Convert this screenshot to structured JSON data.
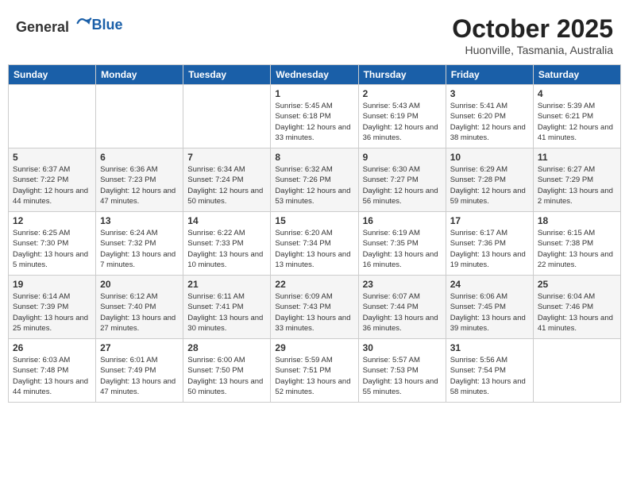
{
  "header": {
    "logo_general": "General",
    "logo_blue": "Blue",
    "month_year": "October 2025",
    "location": "Huonville, Tasmania, Australia"
  },
  "weekdays": [
    "Sunday",
    "Monday",
    "Tuesday",
    "Wednesday",
    "Thursday",
    "Friday",
    "Saturday"
  ],
  "weeks": [
    [
      {
        "day": "",
        "info": ""
      },
      {
        "day": "",
        "info": ""
      },
      {
        "day": "",
        "info": ""
      },
      {
        "day": "1",
        "info": "Sunrise: 5:45 AM\nSunset: 6:18 PM\nDaylight: 12 hours\nand 33 minutes."
      },
      {
        "day": "2",
        "info": "Sunrise: 5:43 AM\nSunset: 6:19 PM\nDaylight: 12 hours\nand 36 minutes."
      },
      {
        "day": "3",
        "info": "Sunrise: 5:41 AM\nSunset: 6:20 PM\nDaylight: 12 hours\nand 38 minutes."
      },
      {
        "day": "4",
        "info": "Sunrise: 5:39 AM\nSunset: 6:21 PM\nDaylight: 12 hours\nand 41 minutes."
      }
    ],
    [
      {
        "day": "5",
        "info": "Sunrise: 6:37 AM\nSunset: 7:22 PM\nDaylight: 12 hours\nand 44 minutes."
      },
      {
        "day": "6",
        "info": "Sunrise: 6:36 AM\nSunset: 7:23 PM\nDaylight: 12 hours\nand 47 minutes."
      },
      {
        "day": "7",
        "info": "Sunrise: 6:34 AM\nSunset: 7:24 PM\nDaylight: 12 hours\nand 50 minutes."
      },
      {
        "day": "8",
        "info": "Sunrise: 6:32 AM\nSunset: 7:26 PM\nDaylight: 12 hours\nand 53 minutes."
      },
      {
        "day": "9",
        "info": "Sunrise: 6:30 AM\nSunset: 7:27 PM\nDaylight: 12 hours\nand 56 minutes."
      },
      {
        "day": "10",
        "info": "Sunrise: 6:29 AM\nSunset: 7:28 PM\nDaylight: 12 hours\nand 59 minutes."
      },
      {
        "day": "11",
        "info": "Sunrise: 6:27 AM\nSunset: 7:29 PM\nDaylight: 13 hours\nand 2 minutes."
      }
    ],
    [
      {
        "day": "12",
        "info": "Sunrise: 6:25 AM\nSunset: 7:30 PM\nDaylight: 13 hours\nand 5 minutes."
      },
      {
        "day": "13",
        "info": "Sunrise: 6:24 AM\nSunset: 7:32 PM\nDaylight: 13 hours\nand 7 minutes."
      },
      {
        "day": "14",
        "info": "Sunrise: 6:22 AM\nSunset: 7:33 PM\nDaylight: 13 hours\nand 10 minutes."
      },
      {
        "day": "15",
        "info": "Sunrise: 6:20 AM\nSunset: 7:34 PM\nDaylight: 13 hours\nand 13 minutes."
      },
      {
        "day": "16",
        "info": "Sunrise: 6:19 AM\nSunset: 7:35 PM\nDaylight: 13 hours\nand 16 minutes."
      },
      {
        "day": "17",
        "info": "Sunrise: 6:17 AM\nSunset: 7:36 PM\nDaylight: 13 hours\nand 19 minutes."
      },
      {
        "day": "18",
        "info": "Sunrise: 6:15 AM\nSunset: 7:38 PM\nDaylight: 13 hours\nand 22 minutes."
      }
    ],
    [
      {
        "day": "19",
        "info": "Sunrise: 6:14 AM\nSunset: 7:39 PM\nDaylight: 13 hours\nand 25 minutes."
      },
      {
        "day": "20",
        "info": "Sunrise: 6:12 AM\nSunset: 7:40 PM\nDaylight: 13 hours\nand 27 minutes."
      },
      {
        "day": "21",
        "info": "Sunrise: 6:11 AM\nSunset: 7:41 PM\nDaylight: 13 hours\nand 30 minutes."
      },
      {
        "day": "22",
        "info": "Sunrise: 6:09 AM\nSunset: 7:43 PM\nDaylight: 13 hours\nand 33 minutes."
      },
      {
        "day": "23",
        "info": "Sunrise: 6:07 AM\nSunset: 7:44 PM\nDaylight: 13 hours\nand 36 minutes."
      },
      {
        "day": "24",
        "info": "Sunrise: 6:06 AM\nSunset: 7:45 PM\nDaylight: 13 hours\nand 39 minutes."
      },
      {
        "day": "25",
        "info": "Sunrise: 6:04 AM\nSunset: 7:46 PM\nDaylight: 13 hours\nand 41 minutes."
      }
    ],
    [
      {
        "day": "26",
        "info": "Sunrise: 6:03 AM\nSunset: 7:48 PM\nDaylight: 13 hours\nand 44 minutes."
      },
      {
        "day": "27",
        "info": "Sunrise: 6:01 AM\nSunset: 7:49 PM\nDaylight: 13 hours\nand 47 minutes."
      },
      {
        "day": "28",
        "info": "Sunrise: 6:00 AM\nSunset: 7:50 PM\nDaylight: 13 hours\nand 50 minutes."
      },
      {
        "day": "29",
        "info": "Sunrise: 5:59 AM\nSunset: 7:51 PM\nDaylight: 13 hours\nand 52 minutes."
      },
      {
        "day": "30",
        "info": "Sunrise: 5:57 AM\nSunset: 7:53 PM\nDaylight: 13 hours\nand 55 minutes."
      },
      {
        "day": "31",
        "info": "Sunrise: 5:56 AM\nSunset: 7:54 PM\nDaylight: 13 hours\nand 58 minutes."
      },
      {
        "day": "",
        "info": ""
      }
    ]
  ]
}
